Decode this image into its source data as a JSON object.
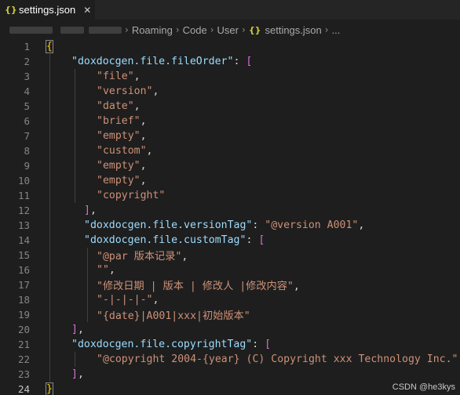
{
  "tab": {
    "icon": "{}",
    "label": "settings.json",
    "close": "✕"
  },
  "breadcrumb": {
    "items": [
      "Roaming",
      "Code",
      "User"
    ],
    "file_icon": "{}",
    "file": "settings.json",
    "more": "...",
    "sep": "›"
  },
  "code": {
    "line_numbers": [
      "1",
      "2",
      "3",
      "4",
      "5",
      "6",
      "7",
      "8",
      "9",
      "10",
      "11",
      "12",
      "13",
      "14",
      "15",
      "16",
      "17",
      "18",
      "19",
      "20",
      "21",
      "22",
      "23",
      "24"
    ],
    "key_fileOrder": "\"doxdocgen.file.fileOrder\"",
    "fileOrder_items": [
      "\"file\"",
      "\"version\"",
      "\"date\"",
      "\"brief\"",
      "\"empty\"",
      "\"custom\"",
      "\"empty\"",
      "\"empty\"",
      "\"copyright\""
    ],
    "key_versionTag": "\"doxdocgen.file.versionTag\"",
    "val_versionTag": "\"@version A001\"",
    "key_customTag": "\"doxdocgen.file.customTag\"",
    "customTag_items": [
      "\"@par 版本记录\"",
      "\"\"",
      "\"修改日期 | 版本 | 修改人 |修改内容\"",
      "\"-|-|-|-\"",
      "\"{date}|A001|xxx|初始版本\""
    ],
    "key_copyrightTag": "\"doxdocgen.file.copyrightTag\"",
    "copyright_items": [
      "\"@copyright 2004-{year} (C) Copyright xxx Technology Inc.\""
    ]
  },
  "watermark": "CSDN @he3kys",
  "colors": {
    "key": "#9cdcfe",
    "string": "#ce9178",
    "bracket1": "#ffd700",
    "bracket2": "#da70d6",
    "background": "#1e1e1e"
  }
}
